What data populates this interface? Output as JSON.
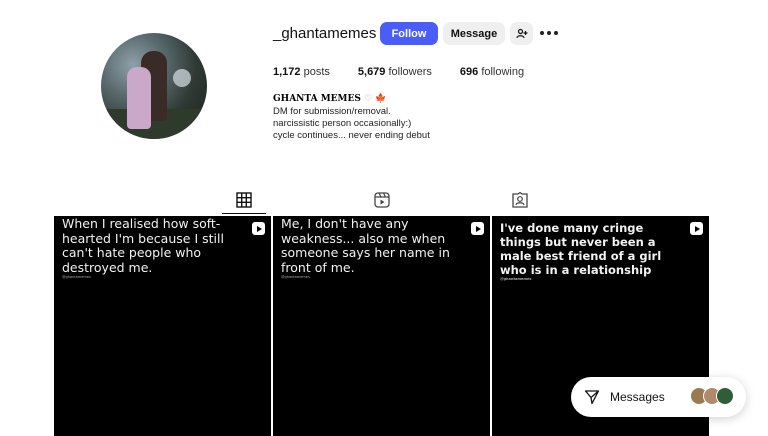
{
  "profile": {
    "username": "_ghantamemes",
    "follow_label": "Follow",
    "message_label": "Message",
    "add_user_icon": "add-user-icon",
    "more_icon": "more-options-icon"
  },
  "stats": {
    "posts_count": "1,172",
    "posts_label": "posts",
    "followers_count": "5,679",
    "followers_label": "followers",
    "following_count": "696",
    "following_label": "following"
  },
  "bio": {
    "name": "GHANTA MEMES",
    "heart": "♡",
    "flag": "🍁",
    "lines": [
      "DM for submission/removal.",
      "narcissistic person occasionally:)",
      "cycle continues... never ending debut"
    ]
  },
  "tabs": [
    {
      "icon": "grid-icon",
      "active": true
    },
    {
      "icon": "reels-icon",
      "active": false
    },
    {
      "icon": "tagged-icon",
      "active": false
    }
  ],
  "posts": [
    {
      "text": "When I realised how soft-hearted I'm because I still can't hate people who destroyed me.",
      "handle": "@ghantamemes"
    },
    {
      "text": "Me, I don't have any weakness... also me when someone says her name in front of me.",
      "handle": "@ghantamemes"
    },
    {
      "text": "I've done many cringe things but never been a male best friend of a girl who is in a relationship",
      "handle": "@ghantamemes"
    }
  ],
  "messages": {
    "label": "Messages",
    "avatar_colors": [
      "#9a7a52",
      "#b08a6a",
      "#2f5d3a"
    ]
  },
  "colors": {
    "follow_button": "#4a5df9",
    "secondary_button": "#efefef"
  }
}
